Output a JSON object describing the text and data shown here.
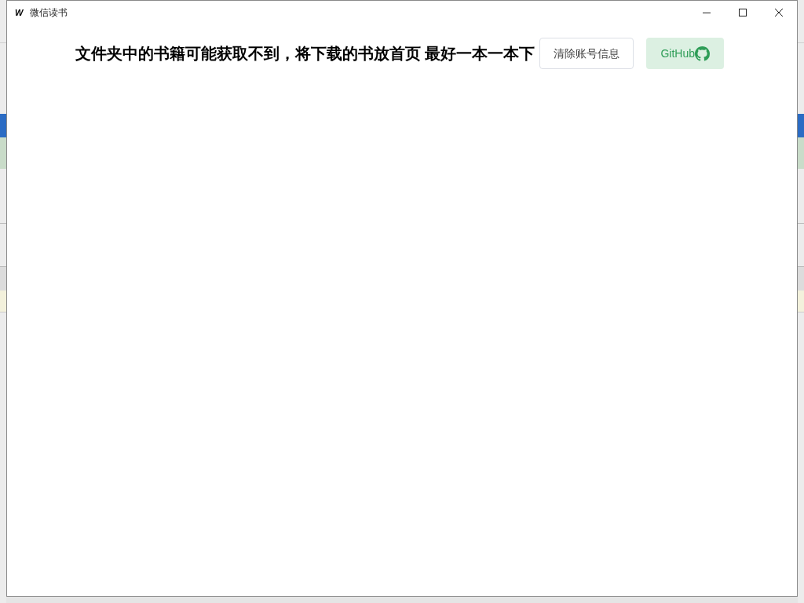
{
  "window": {
    "title": "微信读书",
    "icon_letter": "W"
  },
  "header": {
    "notice": "文件夹中的书籍可能获取不到，将下载的书放首页 最好一本一本下",
    "buttons": [
      {
        "label": "清除账号信息",
        "kind": "outline"
      },
      {
        "label": "GitHub",
        "kind": "github"
      }
    ]
  }
}
